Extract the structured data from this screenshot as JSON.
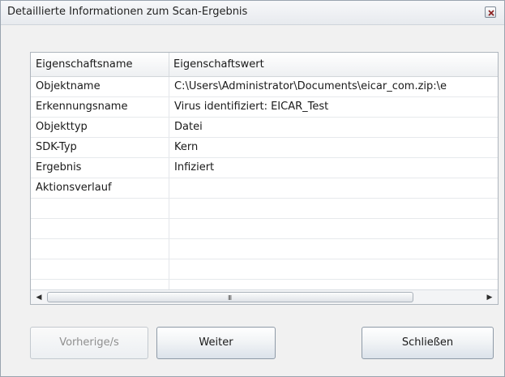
{
  "window": {
    "title": "Detaillierte Informationen zum Scan-Ergebnis"
  },
  "icons": {
    "close": "close-x-icon",
    "scroll_left": "arrow-left-icon",
    "scroll_right": "arrow-right-icon",
    "scroll_grip": "grip-icon"
  },
  "table": {
    "headers": [
      "Eigenschaftsname",
      "Eigenschaftswert"
    ],
    "rows": [
      [
        "Objektname",
        "C:\\Users\\Administrator\\Documents\\eicar_com.zip:\\e"
      ],
      [
        "Erkennungsname",
        "Virus identifiziert: EICAR_Test"
      ],
      [
        "Objekttyp",
        "Datei"
      ],
      [
        "SDK-Typ",
        "Kern"
      ],
      [
        "Ergebnis",
        "Infiziert"
      ],
      [
        "Aktionsverlauf",
        ""
      ],
      [
        "",
        ""
      ],
      [
        "",
        ""
      ],
      [
        "",
        ""
      ],
      [
        "",
        ""
      ],
      [
        "",
        ""
      ]
    ],
    "scrollbar_grip": "III"
  },
  "buttons": {
    "previous": "Vorherige/s",
    "next": "Weiter",
    "close": "Schließen"
  }
}
